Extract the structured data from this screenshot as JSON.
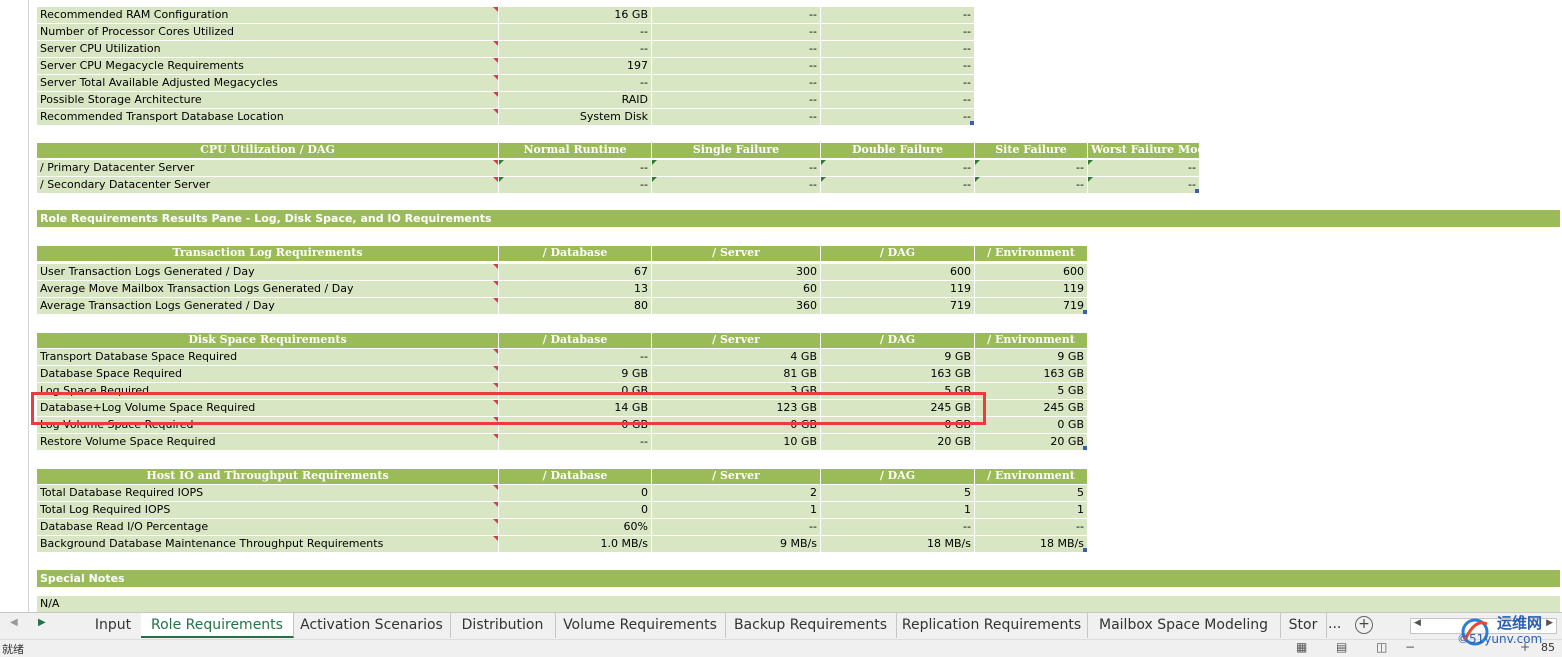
{
  "rows_top": [
    {
      "label": "Recommended RAM Configuration",
      "v": [
        "16 GB",
        "--",
        "--"
      ],
      "tri": "red"
    },
    {
      "label": "Number of Processor Cores Utilized",
      "v": [
        "--",
        "--",
        "--"
      ],
      "tri": ""
    },
    {
      "label": "Server CPU Utilization",
      "v": [
        "--",
        "--",
        "--"
      ],
      "tri": "green"
    },
    {
      "label": "Server CPU Megacycle Requirements",
      "v": [
        "197",
        "--",
        "--"
      ],
      "tri": "red"
    },
    {
      "label": "Server Total Available Adjusted Megacycles",
      "v": [
        "--",
        "--",
        "--"
      ],
      "tri": "red"
    },
    {
      "label": "Possible Storage Architecture",
      "v": [
        "RAID",
        "--",
        "--"
      ],
      "tri": "red"
    },
    {
      "label": "Recommended Transport Database Location",
      "v": [
        "System Disk",
        "--",
        "--"
      ],
      "tri": "red"
    }
  ],
  "cpu": {
    "headers": [
      "CPU Utilization / DAG",
      "Normal Runtime",
      "Single Failure",
      "Double Failure",
      "Site Failure",
      "Worst Failure Mode"
    ],
    "rows": [
      {
        "label": "/ Primary Datacenter Server",
        "v": [
          "--",
          "--",
          "--",
          "--",
          "--"
        ]
      },
      {
        "label": "/ Secondary Datacenter Server",
        "v": [
          "--",
          "--",
          "--",
          "--",
          "--"
        ]
      }
    ]
  },
  "band_role": "Role Requirements Results Pane  - Log, Disk Space, and IO Requirements",
  "log": {
    "headers": [
      "Transaction Log Requirements",
      "/ Database",
      "/ Server",
      "/ DAG",
      "/ Environment"
    ],
    "rows": [
      {
        "label": "User Transaction Logs Generated / Day",
        "v": [
          "67",
          "300",
          "600",
          "600"
        ]
      },
      {
        "label": "Average Move Mailbox Transaction Logs Generated / Day",
        "v": [
          "13",
          "60",
          "119",
          "119"
        ]
      },
      {
        "label": "Average Transaction Logs Generated / Day",
        "v": [
          "80",
          "360",
          "719",
          "719"
        ]
      }
    ]
  },
  "disk": {
    "headers": [
      "Disk Space Requirements",
      "/ Database",
      "/ Server",
      "/ DAG",
      "/ Environment"
    ],
    "rows": [
      {
        "label": "Transport Database Space Required",
        "v": [
          "--",
          "4 GB",
          "9 GB",
          "9 GB"
        ]
      },
      {
        "label": "Database Space Required",
        "v": [
          "9 GB",
          "81 GB",
          "163 GB",
          "163 GB"
        ]
      },
      {
        "label": "Log Space Required",
        "v": [
          "0 GB",
          "3 GB",
          "5 GB",
          "5 GB"
        ]
      },
      {
        "label": "Database+Log Volume Space Required",
        "v": [
          "14 GB",
          "123 GB",
          "245 GB",
          "245 GB"
        ]
      },
      {
        "label": "Log Volume Space Required",
        "v": [
          "0 GB",
          "0 GB",
          "0 GB",
          "0 GB"
        ]
      },
      {
        "label": "Restore Volume Space Required",
        "v": [
          "--",
          "10 GB",
          "20 GB",
          "20 GB"
        ]
      }
    ]
  },
  "io": {
    "headers": [
      "Host IO and Throughput Requirements",
      "/ Database",
      "/ Server",
      "/ DAG",
      "/ Environment"
    ],
    "rows": [
      {
        "label": "Total Database Required IOPS",
        "v": [
          "0",
          "2",
          "5",
          "5"
        ]
      },
      {
        "label": "Total Log Required IOPS",
        "v": [
          "0",
          "1",
          "1",
          "1"
        ]
      },
      {
        "label": "Database Read I/O Percentage",
        "v": [
          "60%",
          "--",
          "--",
          "--"
        ]
      },
      {
        "label": "Background Database Maintenance Throughput Requirements",
        "v": [
          "1.0 MB/s",
          "9 MB/s",
          "18 MB/s",
          "18 MB/s"
        ]
      }
    ]
  },
  "band_notes": "Special Notes",
  "notes_text": "N/A",
  "tabs": [
    "Input",
    "Role Requirements",
    "Activation Scenarios",
    "Distribution",
    "Volume Requirements",
    "Backup Requirements",
    "Replication Requirements",
    "Mailbox Space Modeling",
    "Stor"
  ],
  "active_tab": "Role Requirements",
  "more_tabs": "...",
  "status_text": "就绪",
  "zoom": "85",
  "watermark": {
    "title": "运维网",
    "sub": "©51yunv.com"
  },
  "colors": {
    "header": "#9bbb59",
    "cell": "#d9e6c4",
    "highlight": "#ec3b3b",
    "active_tab": "#217346"
  }
}
